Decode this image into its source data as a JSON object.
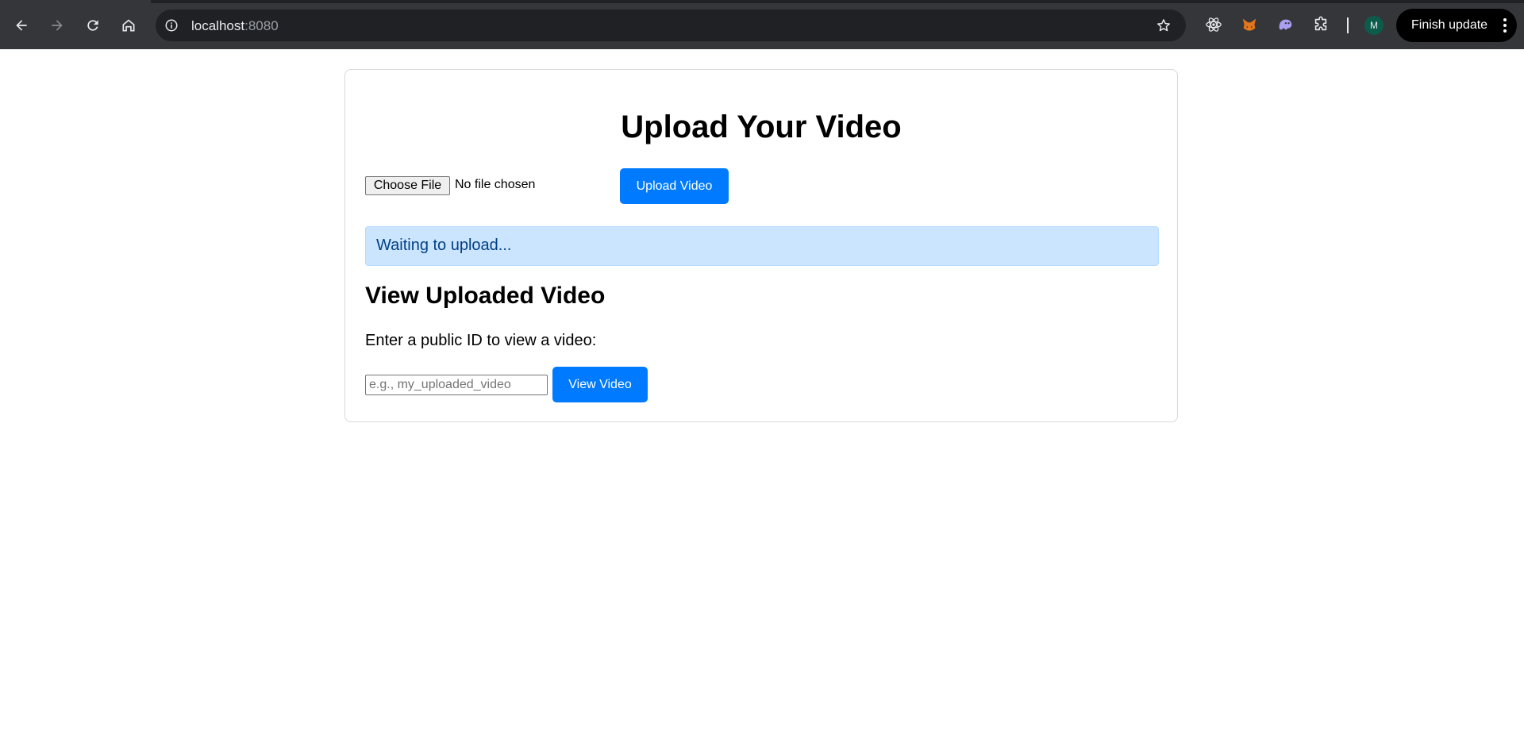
{
  "browser": {
    "url_host": "localhost",
    "url_port": ":8080",
    "finish_update_label": "Finish update",
    "avatar_initial": "M",
    "extensions": [
      "react-devtools-icon",
      "metamask-fox-icon",
      "ghost-extension-icon",
      "puzzle-extensions-icon"
    ]
  },
  "page": {
    "title": "Upload Your Video",
    "file_input": {
      "button_label": "Choose File",
      "status": "No file chosen"
    },
    "upload_button_label": "Upload Video",
    "status_message": "Waiting to upload...",
    "view_section": {
      "heading": "View Uploaded Video",
      "prompt": "Enter a public ID to view a video:",
      "input_placeholder": "e.g., my_uploaded_video",
      "input_value": "",
      "button_label": "View Video"
    }
  },
  "colors": {
    "accent": "#007bff",
    "status_bg": "#cce5ff",
    "status_text": "#004085",
    "chrome_bg": "#35363a"
  }
}
